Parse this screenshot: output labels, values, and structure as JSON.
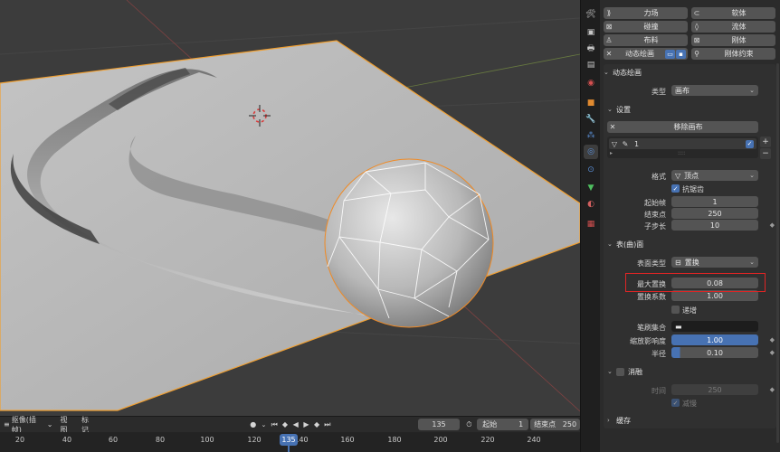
{
  "physics_buttons": [
    {
      "icon": "force-field-icon",
      "label": "力场"
    },
    {
      "icon": "soft-body-icon",
      "label": "软体"
    },
    {
      "icon": "collision-icon",
      "label": "碰撞"
    },
    {
      "icon": "fluid-icon",
      "label": "流体"
    },
    {
      "icon": "cloth-icon",
      "label": "布料"
    },
    {
      "icon": "rigid-body-icon",
      "label": "刚体"
    },
    {
      "icon": "close-icon",
      "label": "动态绘画"
    },
    {
      "icon": "rigid-body-constraint-icon",
      "label": "刚体约束"
    }
  ],
  "dynamic_paint": {
    "header": "动态绘画",
    "type_label": "类型",
    "type_value": "画布",
    "settings_header": "设置",
    "remove_canvas": "移除画布",
    "surface_item_name": "1",
    "format_label": "格式",
    "format_value": "顶点",
    "antialias_label": "抗锯齿",
    "frame_start_label": "起始帧",
    "frame_start_value": "1",
    "frame_end_label": "结束点",
    "frame_end_value": "250",
    "substeps_label": "子步长",
    "substeps_value": "10"
  },
  "surface": {
    "header": "表(曲)面",
    "surface_type_label": "表面类型",
    "surface_type_value": "置换",
    "max_displace_label": "最大置换",
    "max_displace_value": "0.08",
    "displace_factor_label": "置换系数",
    "displace_factor_value": "1.00",
    "incremental_label": "递增",
    "brush_collection_label": "笔刷集合",
    "brush_influence_label": "缩放影响度",
    "brush_influence_value": "1.00",
    "brush_radius_label": "半径",
    "brush_radius_value": "0.10"
  },
  "dissolve": {
    "header": "消融",
    "time_label": "时间",
    "time_value": "250",
    "slow_label": "减慢"
  },
  "cache": {
    "header": "缓存"
  },
  "timeline": {
    "menu_playback": "抠像(插帧)",
    "menu_view": "视图",
    "menu_marker": "标记",
    "current_frame": "135",
    "start_label": "起始",
    "start_value": "1",
    "end_label": "结束点",
    "end_value": "250",
    "ruler_ticks": [
      "20",
      "40",
      "60",
      "80",
      "100",
      "120",
      "140",
      "160",
      "180",
      "200",
      "220",
      "240"
    ],
    "playhead_label": "135"
  }
}
